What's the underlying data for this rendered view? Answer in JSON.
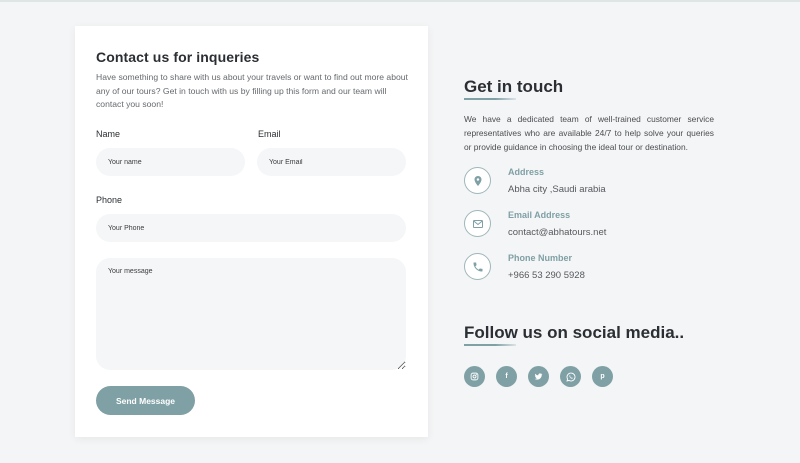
{
  "form": {
    "title": "Contact us for inqueries",
    "description": "Have something to share with us about your travels or want to find out more about any of our tours? Get in touch with us by filling up this form and our team will contact you soon!",
    "name_label": "Name",
    "name_placeholder": "Your name",
    "email_label": "Email",
    "email_placeholder": "Your Email",
    "phone_label": "Phone",
    "phone_placeholder": "Your Phone",
    "message_placeholder": "Your message",
    "send_label": "Send Message"
  },
  "contact": {
    "title": "Get in touch",
    "intro": "We have a dedicated team of well-trained customer service representatives who are available 24/7 to help solve your queries or provide guidance in choosing the ideal tour or destination.",
    "items": [
      {
        "icon": "location-pin-icon",
        "title": "Address",
        "value": "Abha city ,Saudi arabia"
      },
      {
        "icon": "envelope-icon",
        "title": "Email Address",
        "value": "contact@abhatours.net"
      },
      {
        "icon": "phone-icon",
        "title": "Phone Number",
        "value": "+966 53 290 5928"
      }
    ]
  },
  "social": {
    "title": "Follow us on social media..",
    "links": [
      {
        "icon": "instagram-icon"
      },
      {
        "icon": "facebook-icon",
        "glyph": "f"
      },
      {
        "icon": "twitter-icon"
      },
      {
        "icon": "whatsapp-icon"
      },
      {
        "icon": "pinterest-icon",
        "glyph": "p"
      }
    ]
  },
  "colors": {
    "accent": "#7fa0a5",
    "background": "#f4f5f6",
    "card": "#ffffff",
    "heading": "#2b2f33"
  }
}
